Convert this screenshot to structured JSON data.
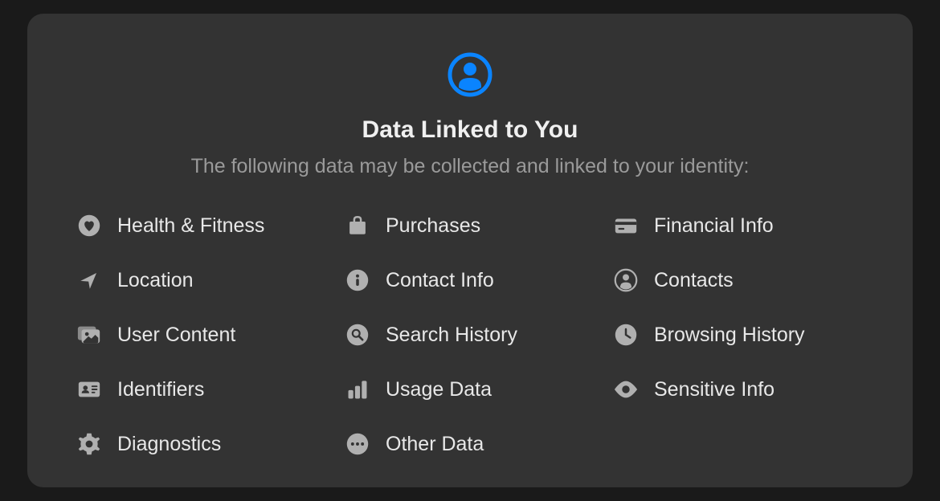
{
  "accent_color": "#0a84ff",
  "icon_color": "#b0b0b0",
  "title": "Data Linked to You",
  "subtitle": "The following data may be collected and linked to your identity:",
  "items": [
    {
      "icon": "heart-circle",
      "label": "Health & Fitness"
    },
    {
      "icon": "bag",
      "label": "Purchases"
    },
    {
      "icon": "creditcard",
      "label": "Financial Info"
    },
    {
      "icon": "location-arrow",
      "label": "Location"
    },
    {
      "icon": "info-circle",
      "label": "Contact Info"
    },
    {
      "icon": "person-circle",
      "label": "Contacts"
    },
    {
      "icon": "photo-stack",
      "label": "User Content"
    },
    {
      "icon": "search-circle",
      "label": "Search History"
    },
    {
      "icon": "clock",
      "label": "Browsing History"
    },
    {
      "icon": "id-card",
      "label": "Identifiers"
    },
    {
      "icon": "bar-chart",
      "label": "Usage Data"
    },
    {
      "icon": "eye",
      "label": "Sensitive Info"
    },
    {
      "icon": "gear",
      "label": "Diagnostics"
    },
    {
      "icon": "ellipsis-circle",
      "label": "Other Data"
    }
  ]
}
